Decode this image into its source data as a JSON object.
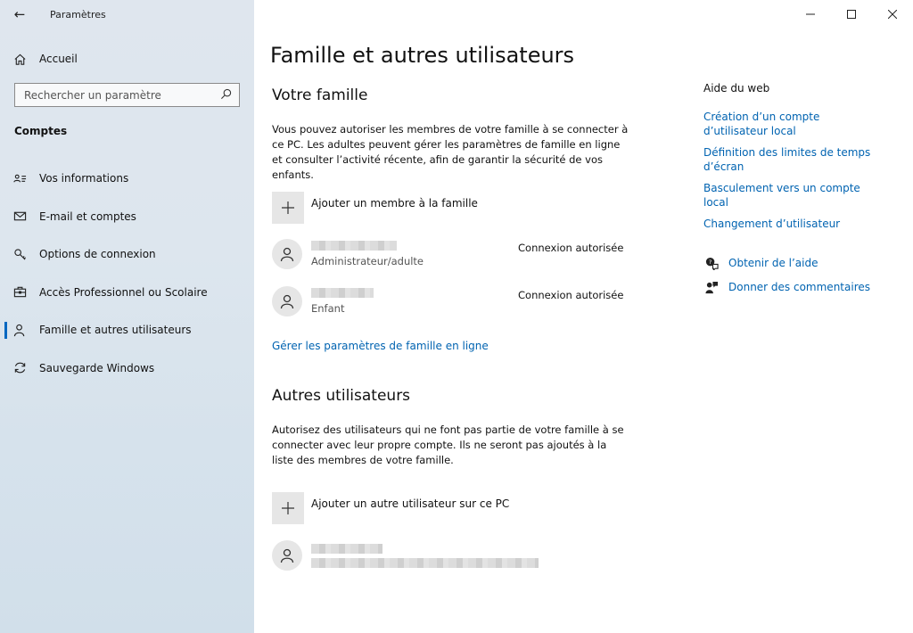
{
  "window": {
    "title": "Paramètres"
  },
  "sidebar": {
    "home_label": "Accueil",
    "search_placeholder": "Rechercher un paramètre",
    "section": "Comptes",
    "items": [
      {
        "label": "Vos informations",
        "icon": "contact-card-icon"
      },
      {
        "label": "E-mail et comptes",
        "icon": "mail-icon"
      },
      {
        "label": "Options de connexion",
        "icon": "key-icon"
      },
      {
        "label": "Accès Professionnel ou Scolaire",
        "icon": "briefcase-icon"
      },
      {
        "label": "Famille et autres utilisateurs",
        "icon": "people-icon",
        "selected": true
      },
      {
        "label": "Sauvegarde Windows",
        "icon": "sync-icon"
      }
    ]
  },
  "main": {
    "title": "Famille et autres utilisateurs",
    "family": {
      "heading": "Votre famille",
      "description": "Vous pouvez autoriser les membres de votre famille à se connecter à ce PC. Les adultes peuvent gérer les paramètres de famille en ligne et consulter l’activité récente, afin de garantir la sécurité de vos enfants.",
      "add_label": "Ajouter un membre à la famille",
      "members": [
        {
          "role": "Administrateur/adulte",
          "status": "Connexion autorisée"
        },
        {
          "role": "Enfant",
          "status": "Connexion autorisée"
        }
      ],
      "manage_link": "Gérer les paramètres de famille en ligne"
    },
    "others": {
      "heading": "Autres utilisateurs",
      "description": "Autorisez des utilisateurs qui ne font pas partie de votre famille à se connecter avec leur propre compte. Ils ne seront pas ajoutés à la liste des membres de votre famille.",
      "add_label": "Ajouter un autre utilisateur sur ce PC"
    }
  },
  "aside": {
    "title": "Aide du web",
    "links": [
      "Création d’un compte d’utilisateur local",
      "Définition des limites de temps d’écran",
      "Basculement vers un compte local",
      "Changement d’utilisateur"
    ],
    "help_label": "Obtenir de l’aide",
    "feedback_label": "Donner des commentaires"
  },
  "colors": {
    "accent": "#0067c0",
    "link": "#0063b1"
  }
}
